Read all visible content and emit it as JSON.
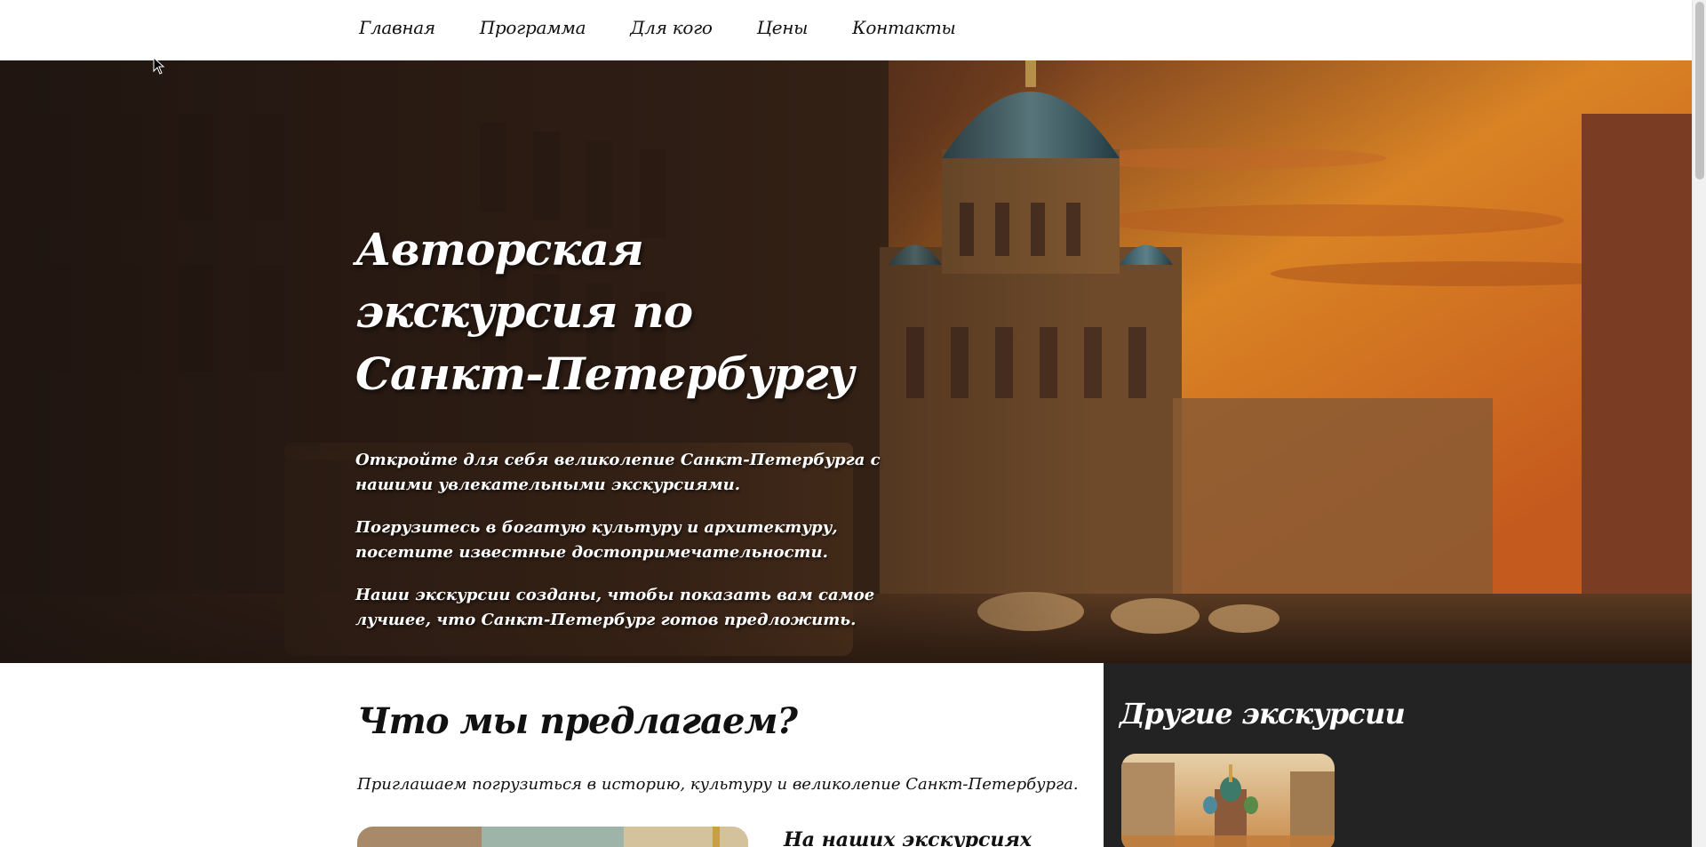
{
  "nav": {
    "items": [
      "Главная",
      "Программа",
      "Для кого",
      "Цены",
      "Контакты"
    ]
  },
  "hero": {
    "title_line1": "Авторская экскурсия по",
    "title_line2": "Санкт-Петербургу",
    "paragraphs": [
      "Откройте для себя великолепие Санкт-Петербурга с нашими увлекательными экскурсиями.",
      "Погрузитесь в богатую культуру и архитектуру, посетите известные достопримечательности.",
      "Наши экскурсии созданы, чтобы показать вам самое лучшее, что Санкт-Петербург готов предложить."
    ]
  },
  "offer": {
    "title": "Что мы предлагаем?",
    "text": "Приглашаем погрузиться в историю, культуру и великолепие Санкт-Петербурга.",
    "subtitle": "На наших экскурсиях"
  },
  "sidebar": {
    "title": "Другие экскурсии"
  },
  "colors": {
    "sidebar_bg": "#232323",
    "hero_sky": "#e08a2a"
  }
}
